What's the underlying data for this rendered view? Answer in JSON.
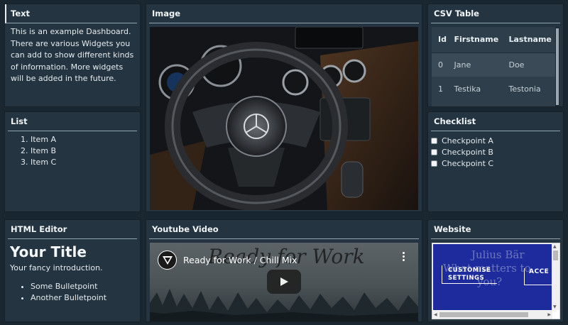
{
  "text_widget": {
    "title": "Text",
    "body": "This is an example Dashboard. There are various Widgets you can add to show different kinds of information. More widgets will be added in the future."
  },
  "list_widget": {
    "title": "List",
    "items": [
      "Item A",
      "Item B",
      "Item C"
    ]
  },
  "image_widget": {
    "title": "Image"
  },
  "csv_widget": {
    "title": "CSV Table",
    "columns": [
      "Id",
      "Firstname",
      "Lastname"
    ],
    "rows": [
      [
        "0",
        "Jane",
        "Doe"
      ],
      [
        "1",
        "Testika",
        "Testonia"
      ]
    ]
  },
  "checklist_widget": {
    "title": "Checklist",
    "items": [
      "Checkpoint A",
      "Checkpoint B",
      "Checkpoint C"
    ]
  },
  "html_editor_widget": {
    "title": "HTML Editor",
    "heading": "Your Title",
    "intro": "Your fancy introduction.",
    "bullets": [
      "Some Bulletpoint",
      "Another Bulletpoint"
    ]
  },
  "youtube_widget": {
    "title": "Youtube Video",
    "video_title": "Ready for Work / Chill Mix",
    "overlay_text": "Ready for Work"
  },
  "website_widget": {
    "title": "Website",
    "ghost_text_1": "Julius Bär",
    "ghost_text_2": "What matters to",
    "ghost_text_3": "you?",
    "cta_1": "CUSTOMISE SETTINGS",
    "cta_2": "ACCE"
  },
  "colors": {
    "background": "#1b2730",
    "panel": "#243440",
    "accent_line": "#8fa3b0",
    "website_brand": "#1d2b9c"
  }
}
